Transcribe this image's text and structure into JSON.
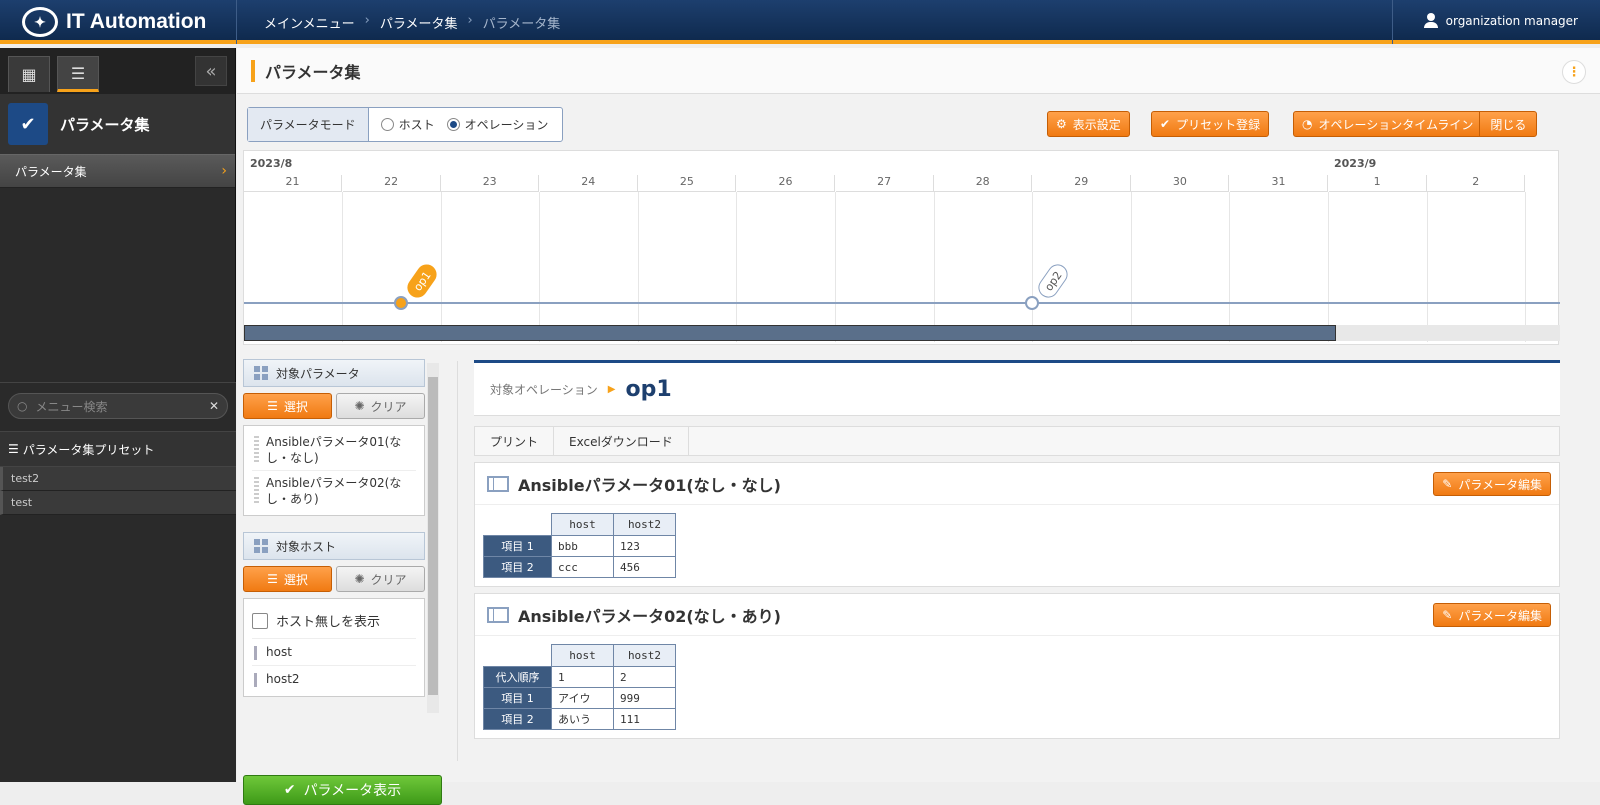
{
  "header": {
    "app_name": "IT Automation",
    "breadcrumb": [
      "メインメニュー",
      "パラメータ集",
      "パラメータ集"
    ],
    "user": "organization manager"
  },
  "sidebar": {
    "title": "パラメータ集",
    "items": [
      {
        "label": "パラメータ集"
      }
    ],
    "search_placeholder": "メニュー検索",
    "preset_title": "パラメータ集プリセット",
    "presets": [
      "test2",
      "test"
    ]
  },
  "page": {
    "title": "パラメータ集",
    "mode_label": "パラメータモード",
    "mode_host": "ホスト",
    "mode_operation": "オペレーション",
    "mode_selected": "オペレーション",
    "btn_display_settings": "表示設定",
    "btn_preset_register": "プリセット登録",
    "btn_timeline": "オペレーションタイムライン",
    "btn_close": "閉じる"
  },
  "timeline": {
    "year_months": [
      "2023/8",
      "2023/9"
    ],
    "days": [
      "21",
      "22",
      "23",
      "24",
      "25",
      "26",
      "27",
      "28",
      "29",
      "30",
      "31",
      "1",
      "2"
    ],
    "operations": [
      {
        "name": "op1",
        "day": "22",
        "selected": true
      },
      {
        "name": "op2",
        "day": "29",
        "selected": false
      }
    ],
    "scroll_fraction": 0.83
  },
  "target_params": {
    "title": "対象パラメータ",
    "select_label": "選択",
    "clear_label": "クリア",
    "items": [
      "Ansibleパラメータ01(なし・なし)",
      "Ansibleパラメータ02(なし・あり)"
    ]
  },
  "target_hosts": {
    "title": "対象ホスト",
    "select_label": "選択",
    "clear_label": "クリア",
    "show_no_host_label": "ホスト無しを表示",
    "hosts": [
      "host",
      "host2"
    ]
  },
  "show_params_button": "パラメータ表示",
  "operation": {
    "label": "対象オペレーション",
    "name": "op1",
    "print": "プリント",
    "excel": "Excelダウンロード",
    "edit_label": "パラメータ編集",
    "cards": [
      {
        "title": "Ansibleパラメータ01(なし・なし)",
        "columns": [
          "host",
          "host2"
        ],
        "rows": [
          {
            "label": "項目 1",
            "values": [
              "bbb",
              "123"
            ]
          },
          {
            "label": "項目 2",
            "values": [
              "ccc",
              "456"
            ]
          }
        ]
      },
      {
        "title": "Ansibleパラメータ02(なし・あり)",
        "columns": [
          "host",
          "host2"
        ],
        "rows": [
          {
            "label": "代入順序",
            "values": [
              "1",
              "2"
            ]
          },
          {
            "label": "項目 1",
            "values": [
              "アイウ",
              "999"
            ]
          },
          {
            "label": "項目 2",
            "values": [
              "あいう",
              "111"
            ]
          }
        ]
      }
    ]
  },
  "colors": {
    "accent": "#f7a21a",
    "navy": "#1d3f6e",
    "green": "#3e9a18"
  }
}
